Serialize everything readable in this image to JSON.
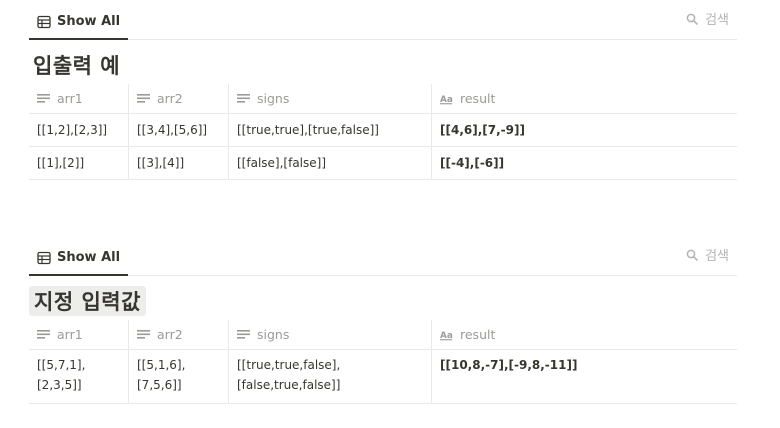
{
  "blocks": [
    {
      "view_tab_label": "Show All",
      "search_label": "검색",
      "title": "입출력 예",
      "columns": [
        "arr1",
        "arr2",
        "signs",
        "result"
      ],
      "rows": [
        [
          "[[1,2],[2,3]]",
          "[[3,4],[5,6]]",
          "[[true,true],[true,false]]",
          "[[4,6],[7,-9]]"
        ],
        [
          "[[1],[2]]",
          "[[3],[4]]",
          "[[false],[false]]",
          "[[-4],[-6]]"
        ]
      ]
    },
    {
      "view_tab_label": "Show All",
      "search_label": "검색",
      "title": "지정 입력값",
      "columns": [
        "arr1",
        "arr2",
        "signs",
        "result"
      ],
      "rows": [
        [
          "[[5,7,1],\n[2,3,5]]",
          "[[5,1,6],\n[7,5,6]]",
          "[[true,true,false],\n[false,true,false]]",
          "[[10,8,-7],[-9,8,-11]]"
        ]
      ]
    }
  ],
  "icons": {
    "view_tab": "table-icon",
    "search": "search-icon",
    "text_property": "text-lines-icon",
    "title_property": "aa-icon"
  },
  "colors": {
    "text": "#37352f",
    "muted": "#9b9a97",
    "border": "#e9e9e7",
    "highlight_bg": "#ededeb"
  }
}
